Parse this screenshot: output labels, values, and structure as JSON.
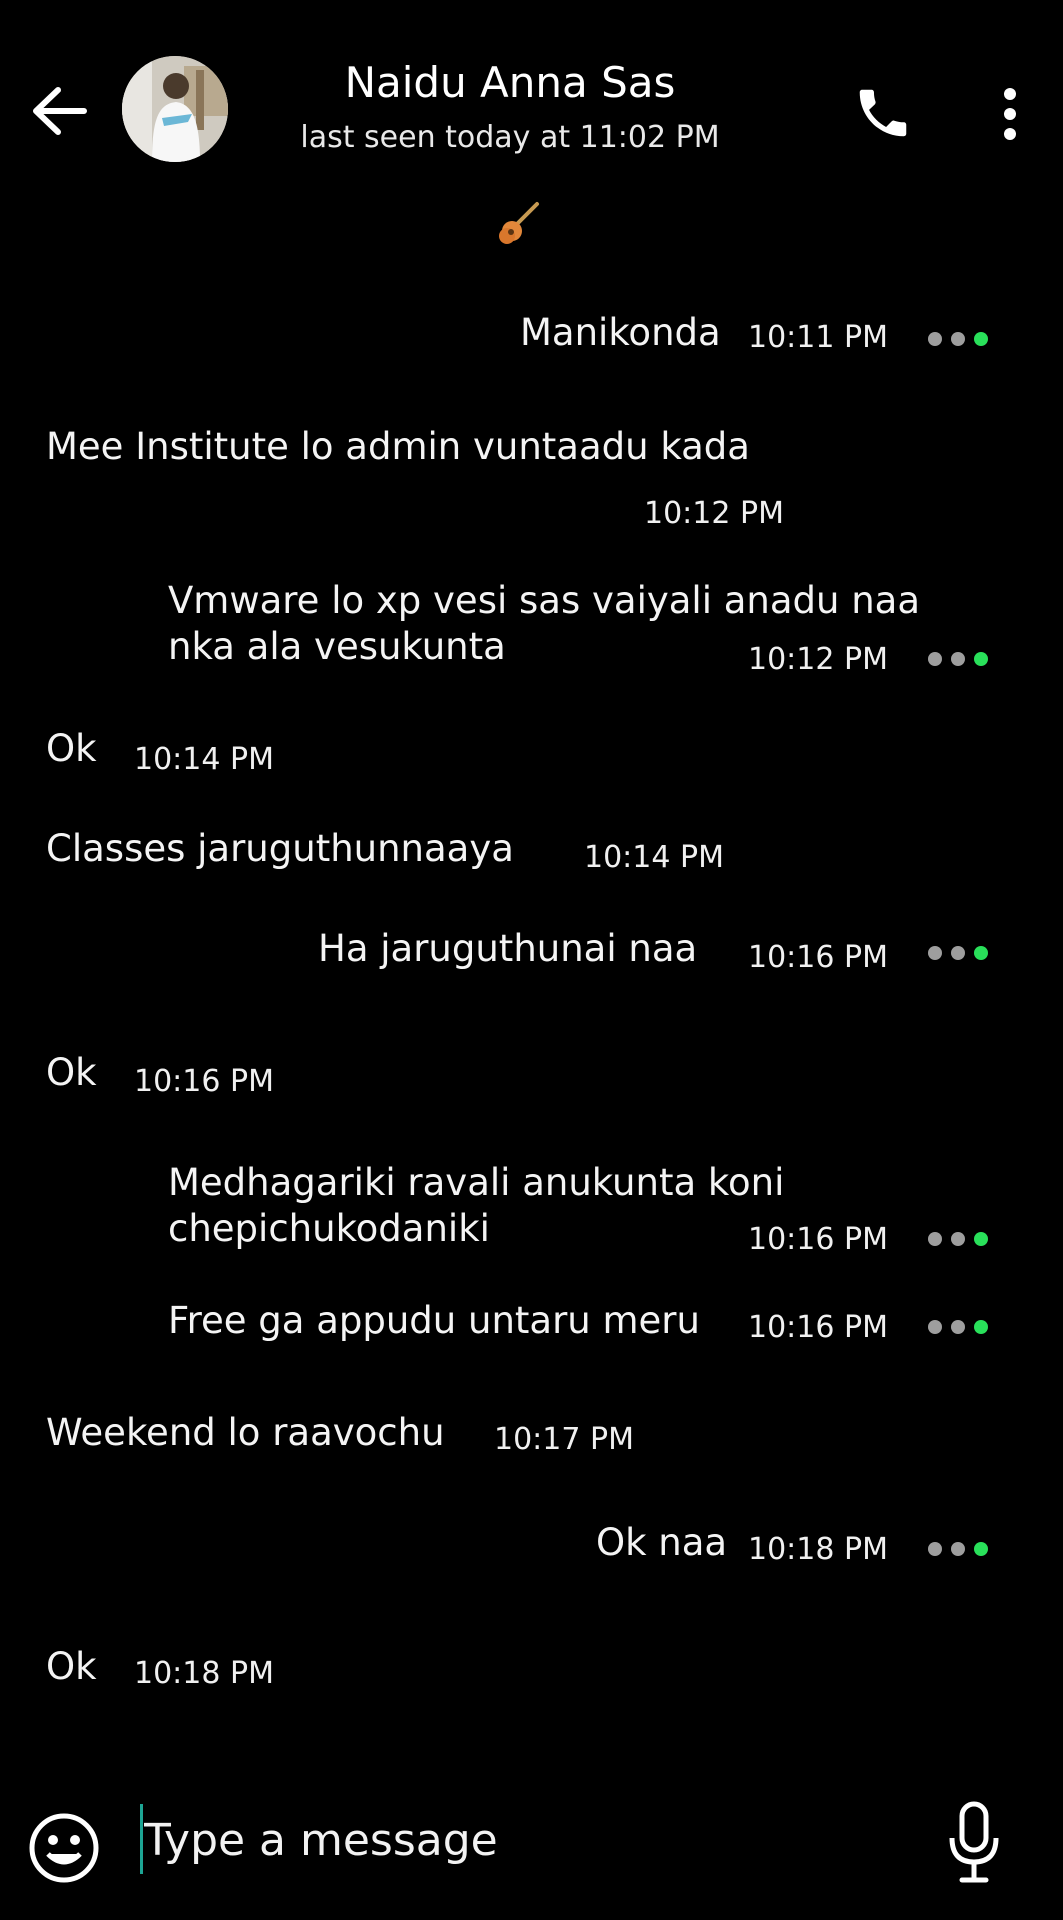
{
  "header": {
    "contact_name": "Naidu Anna Sas",
    "last_seen": "last seen today at 11:02 PM",
    "back_icon": "arrow-left-icon",
    "call_icon": "phone-icon",
    "menu_icon": "more-vertical-icon"
  },
  "status_emoji": "guitar-icon",
  "messages": [
    {
      "direction": "outgoing",
      "lines": [
        "Manikonda"
      ],
      "time": "10:11 PM",
      "delivered": true
    },
    {
      "direction": "incoming",
      "lines": [
        "Mee Institute lo admin vuntaadu kada"
      ],
      "time": "10:12 PM"
    },
    {
      "direction": "outgoing",
      "lines": [
        "Vmware lo xp vesi sas vaiyali anadu naa",
        "nka ala vesukunta"
      ],
      "time": "10:12 PM",
      "delivered": true
    },
    {
      "direction": "incoming",
      "lines": [
        "Ok"
      ],
      "time": "10:14 PM"
    },
    {
      "direction": "incoming",
      "lines": [
        "Classes jaruguthunnaaya"
      ],
      "time": "10:14 PM"
    },
    {
      "direction": "outgoing",
      "lines": [
        "Ha jaruguthunai naa"
      ],
      "time": "10:16 PM",
      "delivered": true
    },
    {
      "direction": "incoming",
      "lines": [
        "Ok"
      ],
      "time": "10:16 PM"
    },
    {
      "direction": "outgoing",
      "lines": [
        "Medhagariki ravali anukunta koni",
        "chepichukodaniki"
      ],
      "time": "10:16 PM",
      "delivered": true
    },
    {
      "direction": "outgoing",
      "lines": [
        "Free ga appudu untaru meru"
      ],
      "time": "10:16 PM",
      "delivered": true
    },
    {
      "direction": "incoming",
      "lines": [
        "Weekend lo raavochu"
      ],
      "time": "10:17 PM"
    },
    {
      "direction": "outgoing",
      "lines": [
        "Ok naa"
      ],
      "time": "10:18 PM",
      "delivered": true
    },
    {
      "direction": "incoming",
      "lines": [
        "Ok"
      ],
      "time": "10:18 PM"
    }
  ],
  "input": {
    "placeholder": "Type a message",
    "emoji_icon": "smiley-icon",
    "mic_icon": "microphone-icon"
  },
  "colors": {
    "background": "#000000",
    "text": "#f4f4f4",
    "tick_grey": "#9e9e9e",
    "tick_green": "#29e05a",
    "cursor": "#1da594"
  }
}
